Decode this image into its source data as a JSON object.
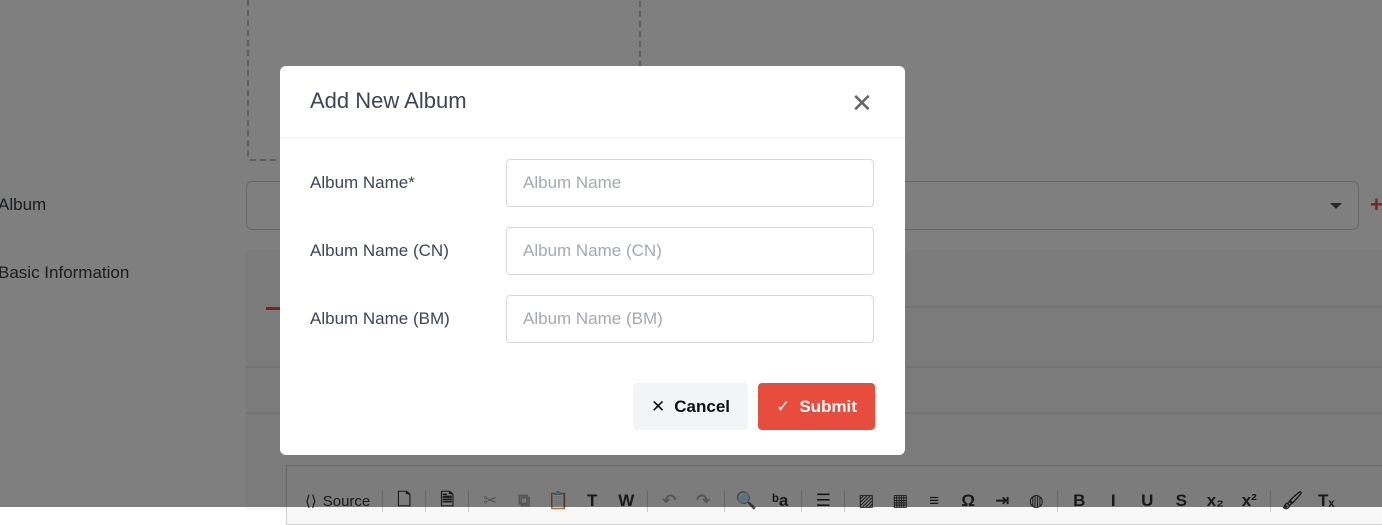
{
  "background": {
    "album_label": "Album",
    "basic_info_label": "Basic Information",
    "add_album_icon": "plus-icon",
    "editor_toolbar": {
      "source_label": "Source",
      "groups": [
        [
          {
            "icon": "new-page-icon",
            "glyph": "🗋"
          }
        ],
        [
          {
            "icon": "preview-icon",
            "glyph": "🗎"
          }
        ],
        [
          {
            "icon": "cut-icon",
            "glyph": "✂",
            "disabled": true
          },
          {
            "icon": "copy-icon",
            "glyph": "⧉",
            "disabled": true
          },
          {
            "icon": "paste-icon",
            "glyph": "📋"
          },
          {
            "icon": "paste-text-icon",
            "glyph": "T"
          },
          {
            "icon": "paste-word-icon",
            "glyph": "W"
          }
        ],
        [
          {
            "icon": "undo-icon",
            "glyph": "↶",
            "disabled": true
          },
          {
            "icon": "redo-icon",
            "glyph": "↷",
            "disabled": true
          }
        ],
        [
          {
            "icon": "find-icon",
            "glyph": "🔍"
          },
          {
            "icon": "replace-icon",
            "glyph": "ᵇa"
          }
        ],
        [
          {
            "icon": "select-all-icon",
            "glyph": "☰"
          }
        ],
        [
          {
            "icon": "image-icon",
            "glyph": "▨"
          },
          {
            "icon": "table-icon",
            "glyph": "▦"
          },
          {
            "icon": "horizontal-line-icon",
            "glyph": "≡"
          },
          {
            "icon": "special-char-icon",
            "glyph": "Ω"
          },
          {
            "icon": "page-break-icon",
            "glyph": "⇥"
          },
          {
            "icon": "iframe-icon",
            "glyph": "◍"
          }
        ],
        [
          {
            "icon": "bold-icon",
            "glyph": "B"
          },
          {
            "icon": "italic-icon",
            "glyph": "I"
          },
          {
            "icon": "underline-icon",
            "glyph": "U"
          },
          {
            "icon": "strike-icon",
            "glyph": "S"
          },
          {
            "icon": "subscript-icon",
            "glyph": "x₂"
          },
          {
            "icon": "superscript-icon",
            "glyph": "x²"
          }
        ],
        [
          {
            "icon": "copy-format-icon",
            "glyph": "🖌"
          },
          {
            "icon": "remove-format-icon",
            "glyph": "Tₓ"
          }
        ]
      ]
    }
  },
  "modal": {
    "title": "Add New Album",
    "close_icon": "close-icon",
    "fields": [
      {
        "label": "Album Name*",
        "placeholder": "Album Name",
        "value": ""
      },
      {
        "label": "Album Name (CN)",
        "placeholder": "Album Name (CN)",
        "value": ""
      },
      {
        "label": "Album Name (BM)",
        "placeholder": "Album Name (BM)",
        "value": ""
      }
    ],
    "cancel_label": "Cancel",
    "submit_label": "Submit",
    "colors": {
      "submit": "#e74c3c",
      "cancel_bg": "#f3f4f6"
    }
  }
}
